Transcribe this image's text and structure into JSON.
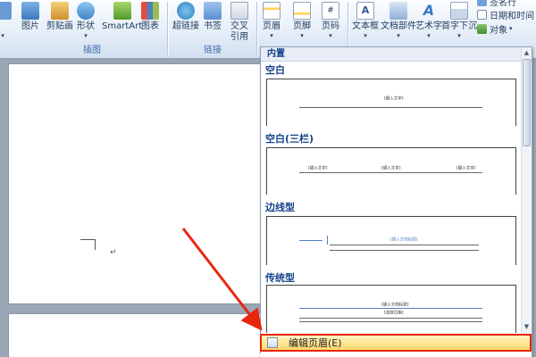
{
  "ribbon": {
    "buttons": {
      "picture": "图片",
      "clipart": "剪贴画",
      "shapes": "形状",
      "smartart": "SmartArt",
      "chart": "图表",
      "hyperlink": "超链接",
      "bookmark": "书签",
      "crossref_line1": "交叉",
      "crossref_line2": "引用",
      "header": "页眉",
      "footer": "页脚",
      "pagenum": "页码",
      "textbox": "文本框",
      "quickparts": "文档部件",
      "wordart": "艺术字",
      "dropcap": "首字下沉"
    },
    "small": {
      "signature": "签名行",
      "datetime": "日期和时间",
      "object": "对象"
    },
    "groups": {
      "illustrations": "插图",
      "links": "链接"
    }
  },
  "gallery": {
    "section": "内置",
    "items": [
      {
        "label": "空白",
        "placeholder": "[键入文字]"
      },
      {
        "label": "空白(三栏)",
        "placeholder": "[键入文字]"
      },
      {
        "label": "边线型",
        "placeholder": "[键入文档标题]"
      },
      {
        "label": "传统型",
        "placeholder": "[键入文档标题]",
        "placeholder2": "[选取日期]"
      }
    ]
  },
  "menu": {
    "edit_header": "编辑页眉(E)"
  },
  "document": {
    "para_mark": "↵"
  },
  "colors": {
    "highlight_border": "#e8270f",
    "arrow": "#e8270f",
    "ribbon_text": "#1e395b",
    "gallery_label": "#15428b"
  }
}
